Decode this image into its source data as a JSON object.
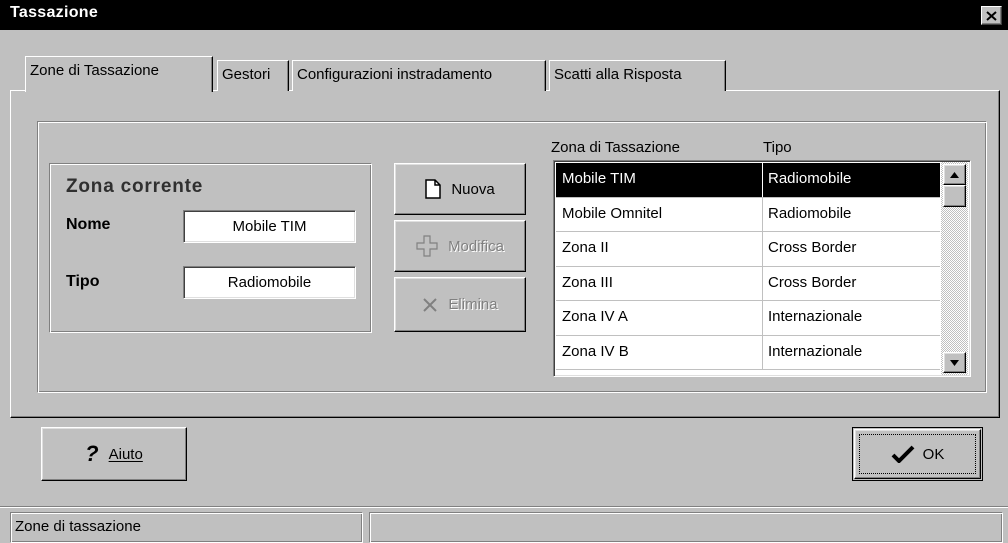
{
  "window": {
    "title": "Tassazione"
  },
  "tabs": [
    {
      "label": "Zone di Tassazione",
      "active": true
    },
    {
      "label": "Gestori",
      "active": false
    },
    {
      "label": "Configurazioni instradamento",
      "active": false
    },
    {
      "label": "Scatti alla Risposta",
      "active": false
    }
  ],
  "current_zone": {
    "group_title": "Zona corrente",
    "name_label": "Nome",
    "name_value": "Mobile TIM",
    "type_label": "Tipo",
    "type_value": "Radiomobile"
  },
  "actions": {
    "new_label": "Nuova",
    "edit_label": "Modifica",
    "delete_label": "Elimina"
  },
  "table": {
    "columns": [
      "Zona di Tassazione",
      "Tipo"
    ],
    "rows": [
      {
        "zona": "Mobile TIM",
        "tipo": "Radiomobile",
        "selected": true
      },
      {
        "zona": "Mobile Omnitel",
        "tipo": "Radiomobile"
      },
      {
        "zona": "Zona II",
        "tipo": "Cross Border"
      },
      {
        "zona": "Zona III",
        "tipo": "Cross Border"
      },
      {
        "zona": "Zona IV A",
        "tipo": "Internazionale"
      },
      {
        "zona": "Zona IV B",
        "tipo": "Internazionale"
      }
    ]
  },
  "footer": {
    "help_label": "Aiuto",
    "ok_label": "OK"
  },
  "status": {
    "left_text": "Zone di tassazione",
    "right_text": ""
  },
  "colors": {
    "face": "#c0c0c0",
    "titlebar": "#000000",
    "selection": "#000000",
    "disabled_text": "#808080"
  }
}
